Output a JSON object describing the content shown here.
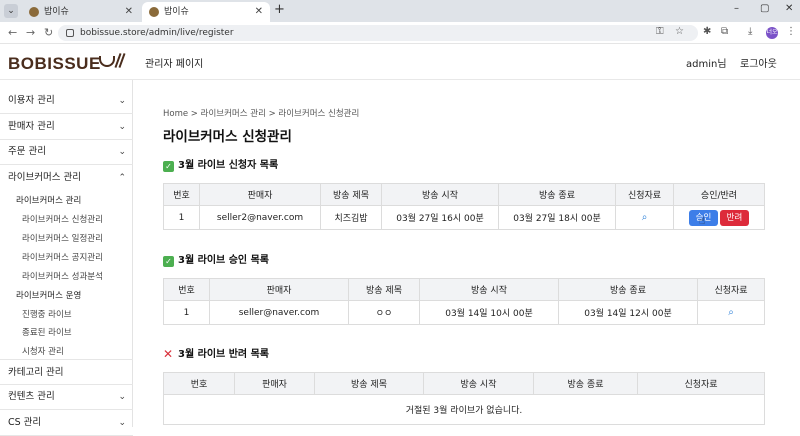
{
  "browser": {
    "tabs": [
      {
        "title": "밥이슈",
        "active": false
      },
      {
        "title": "밥이슈",
        "active": true
      }
    ],
    "url": "bobissue.store/admin/live/register",
    "profile_initials": "너오"
  },
  "header": {
    "logo": "BOBISSUE",
    "title": "관리자 페이지",
    "user": "admin님",
    "logout": "로그아웃"
  },
  "sidebar": {
    "menus": [
      {
        "label": "이용자 관리"
      },
      {
        "label": "판매자 관리"
      },
      {
        "label": "주문 관리"
      },
      {
        "label": "라이브커머스 관리"
      },
      {
        "label": "카테고리 관리"
      },
      {
        "label": "컨텐츠 관리"
      },
      {
        "label": "CS 관리"
      }
    ],
    "live_groups": [
      {
        "title": "라이브커머스 관리",
        "items": [
          "라이브커머스 신청관리",
          "라이브커머스 일정관리",
          "라이브커머스 공지관리",
          "라이브커머스 성과분석"
        ]
      },
      {
        "title": "라이브커머스 운영",
        "items": [
          "진행중 라이브",
          "종료된 라이브",
          "시청자 관리"
        ]
      }
    ]
  },
  "main": {
    "breadcrumb": "Home  > 라이브커머스 관리  > 라이브커머스 신청관리",
    "page_title": "라이브커머스 신청관리",
    "applicants": {
      "title": "3월 라이브 신청자 목록",
      "headers": [
        "번호",
        "판매자",
        "방송 제목",
        "방송 시작",
        "방송 종료",
        "신청자료",
        "승인/반려"
      ],
      "rows": [
        {
          "no": "1",
          "seller": "seller2@naver.com",
          "title": "치즈김밥",
          "start": "03월 27일 16시 00분",
          "end": "03월 27일 18시 00분"
        }
      ],
      "approve_label": "승인",
      "reject_label": "반려"
    },
    "approved": {
      "title": "3월 라이브 승인 목록",
      "headers": [
        "번호",
        "판매자",
        "방송 제목",
        "방송 시작",
        "방송 종료",
        "신청자료"
      ],
      "rows": [
        {
          "no": "1",
          "seller": "seller@naver.com",
          "title": "ㅇㅇ",
          "start": "03월 14일 10시 00분",
          "end": "03월 14일 12시 00분"
        }
      ]
    },
    "rejected": {
      "title": "3월 라이브 반려 목록",
      "headers": [
        "번호",
        "판매자",
        "방송 제목",
        "방송 시작",
        "방송 종료",
        "신청자료"
      ],
      "empty_message": "거절된 3월 라이브가 없습니다."
    }
  },
  "colors": {
    "approve": "#3d7ee8",
    "reject": "#dd2a3a",
    "check": "#4caf50",
    "logo": "#4a2d1d"
  }
}
